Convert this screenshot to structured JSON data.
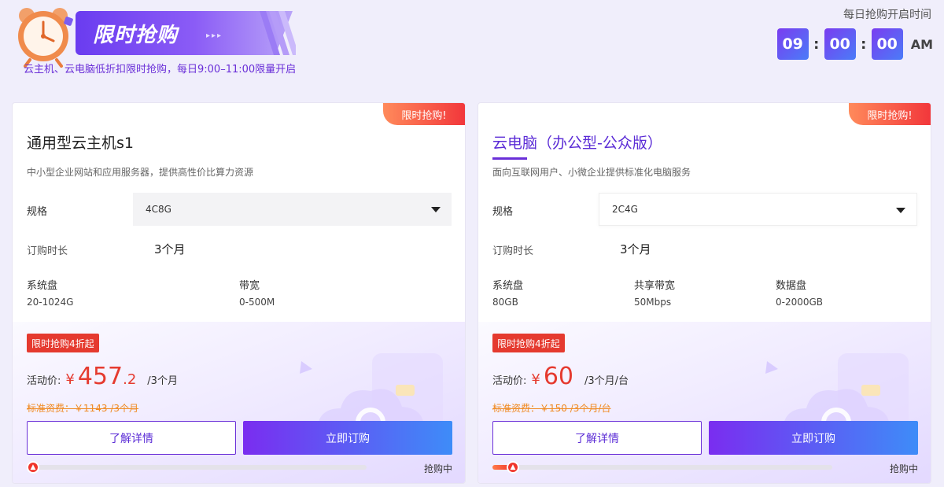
{
  "header": {
    "banner_title": "限时抢购",
    "banner_arrows": "▸▸▸",
    "subtitle": "云主机、云电脑低折扣限时抢购，每日9:00–11:00限量开启",
    "countdown_label": "每日抢购开启时间",
    "countdown": {
      "hours": "09",
      "minutes": "00",
      "seconds": "00",
      "ampm": "AM",
      "separator": ":"
    }
  },
  "colors": {
    "accent": "#6a2fd8",
    "price": "#e53a2f",
    "original_price": "#f08a22"
  },
  "cards": [
    {
      "badge": "限时抢购!",
      "title": "通用型云主机s1",
      "desc": "中小型企业网站和应用服务器，提供高性价比算力资源",
      "spec_label": "规格",
      "spec_value": "4C8G",
      "duration_label": "订购时长",
      "duration_value": "3个月",
      "attrs": [
        {
          "name": "系统盘",
          "value": "20-1024G"
        },
        {
          "name": "带宽",
          "value": "0-500M"
        }
      ],
      "promo_tag": "限时抢购4折起",
      "price_label": "活动价:",
      "currency": "¥",
      "price_int": "457",
      "price_dec": ".2",
      "price_unit": "/3个月",
      "orig_price": "标准资费：￥1143 /3个月",
      "detail_btn": "了解详情",
      "order_btn": "立即订购",
      "progress": 0.0,
      "status": "抢购中"
    },
    {
      "badge": "限时抢购!",
      "title": "云电脑（办公型-公众版）",
      "desc": "面向互联网用户、小微企业提供标准化电脑服务",
      "spec_label": "规格",
      "spec_value": "2C4G",
      "duration_label": "订购时长",
      "duration_value": "3个月",
      "attrs": [
        {
          "name": "系统盘",
          "value": "80GB"
        },
        {
          "name": "共享带宽",
          "value": "50Mbps"
        },
        {
          "name": "数据盘",
          "value": "0-2000GB"
        }
      ],
      "promo_tag": "限时抢购4折起",
      "price_label": "活动价:",
      "currency": "¥",
      "price_int": "60",
      "price_dec": "",
      "price_unit": "/3个月/台",
      "orig_price": "标准资费：￥150 /3个月/台",
      "detail_btn": "了解详情",
      "order_btn": "立即订购",
      "progress": 0.06,
      "status": "抢购中"
    }
  ]
}
